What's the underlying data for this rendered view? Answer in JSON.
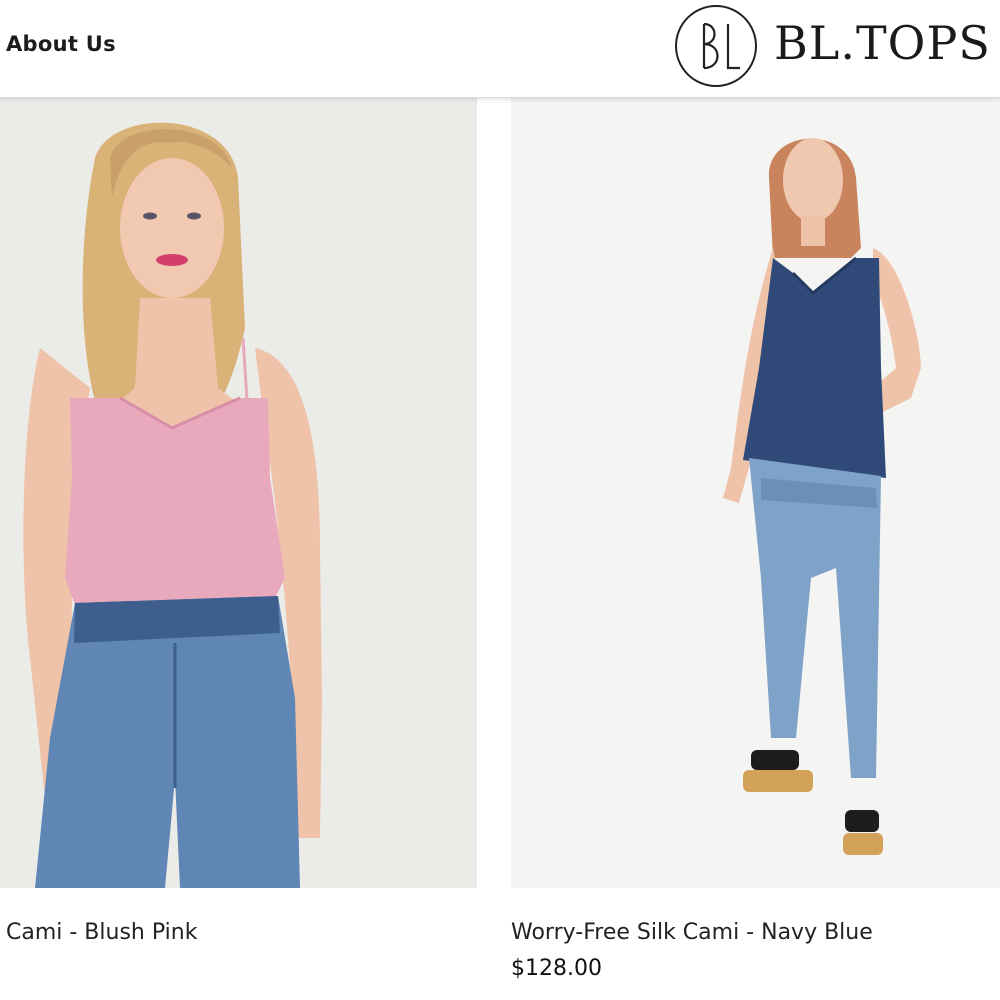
{
  "header": {
    "nav_about": "About Us",
    "logo": {
      "monogram": "BL",
      "text": "BL.TOPS"
    }
  },
  "products": [
    {
      "title": "Cami - Blush Pink",
      "price": "",
      "image_description": "model-in-blush-pink-cami-and-jeans",
      "top_color": "#e9a9bd"
    },
    {
      "title": "Worry-Free Silk Cami - Navy Blue",
      "price": "$128.00",
      "image_description": "model-in-navy-blue-cami-and-jeans",
      "top_color": "#2f4a78"
    }
  ],
  "colors": {
    "denim": "#5f86b5",
    "denim_dark": "#3e5f8e",
    "skin": "#efc3a9",
    "hair_blonde": "#d9b278",
    "hair_red": "#c9845e"
  }
}
